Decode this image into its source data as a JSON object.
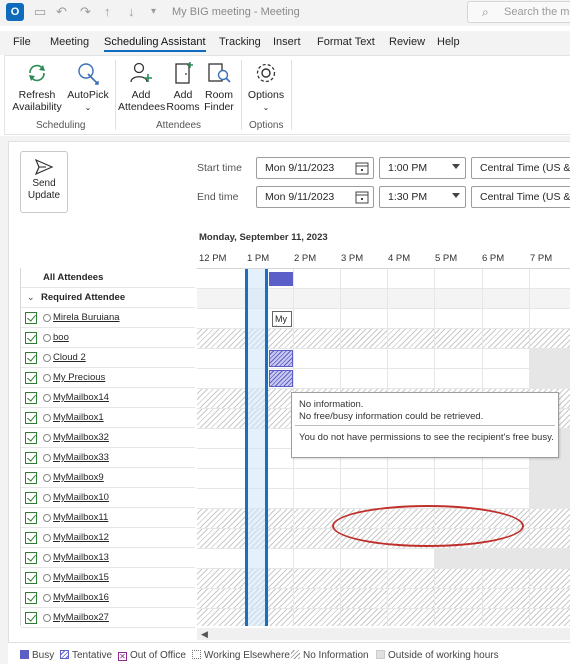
{
  "window": {
    "title": "My BIG meeting  -  Meeting",
    "search_placeholder": "Search the me",
    "app_icon_letter": "O"
  },
  "menu": {
    "tabs": [
      "File",
      "Meeting",
      "Scheduling Assistant",
      "Tracking",
      "Insert",
      "Format Text",
      "Review",
      "Help"
    ],
    "active": "Scheduling Assistant"
  },
  "ribbon": {
    "refresh": "Refresh\nAvailability",
    "autopick": "AutoPick",
    "add_attendees": "Add\nAttendees",
    "add_rooms": "Add\nRooms",
    "room_finder": "Room\nFinder",
    "options": "Options",
    "groups": {
      "scheduling": "Scheduling",
      "attendees": "Attendees",
      "options": "Options"
    }
  },
  "send_update": "Send\nUpdate",
  "time": {
    "start_label": "Start time",
    "end_label": "End time",
    "start_date": "Mon 9/11/2023",
    "start_time": "1:00 PM",
    "end_date": "Mon 9/11/2023",
    "end_time": "1:30 PM",
    "timezone": "Central Time (US & C"
  },
  "day_header": "Monday, September 11, 2023",
  "hours": [
    "12 PM",
    "1 PM",
    "2 PM",
    "3 PM",
    "4 PM",
    "5 PM",
    "6 PM",
    "7 PM"
  ],
  "attendees": {
    "all_label": "All Attendees",
    "required_label": "Required Attendee",
    "list": [
      "Mirela Buruiana",
      "boo",
      "Cloud 2",
      "My Precious",
      "MyMailbox14",
      "MyMailbox1",
      "MyMailbox32",
      "MyMailbox33",
      "MyMailbox9",
      "MyMailbox10",
      "MyMailbox11",
      "MyMailbox12",
      "MyMailbox13",
      "MyMailbox15",
      "MyMailbox16",
      "MyMailbox27"
    ]
  },
  "meeting_label": "My I",
  "tooltip": {
    "line1": "No information.",
    "line2": "No free/busy information could be retrieved.",
    "line3": "You do not have permissions to see the recipient's free busy."
  },
  "legend": {
    "busy": "Busy",
    "tentative": "Tentative",
    "out_of_office": "Out of Office",
    "working_elsewhere": "Working Elsewhere",
    "no_information": "No Information",
    "outside_hours": "Outside of working hours"
  },
  "colors": {
    "accent": "#0f6cbd",
    "busy": "#5b5fc7",
    "meeting_border": "#1b6fc2",
    "annotation": "#c0302b",
    "checkbox": "#2e7d32"
  }
}
